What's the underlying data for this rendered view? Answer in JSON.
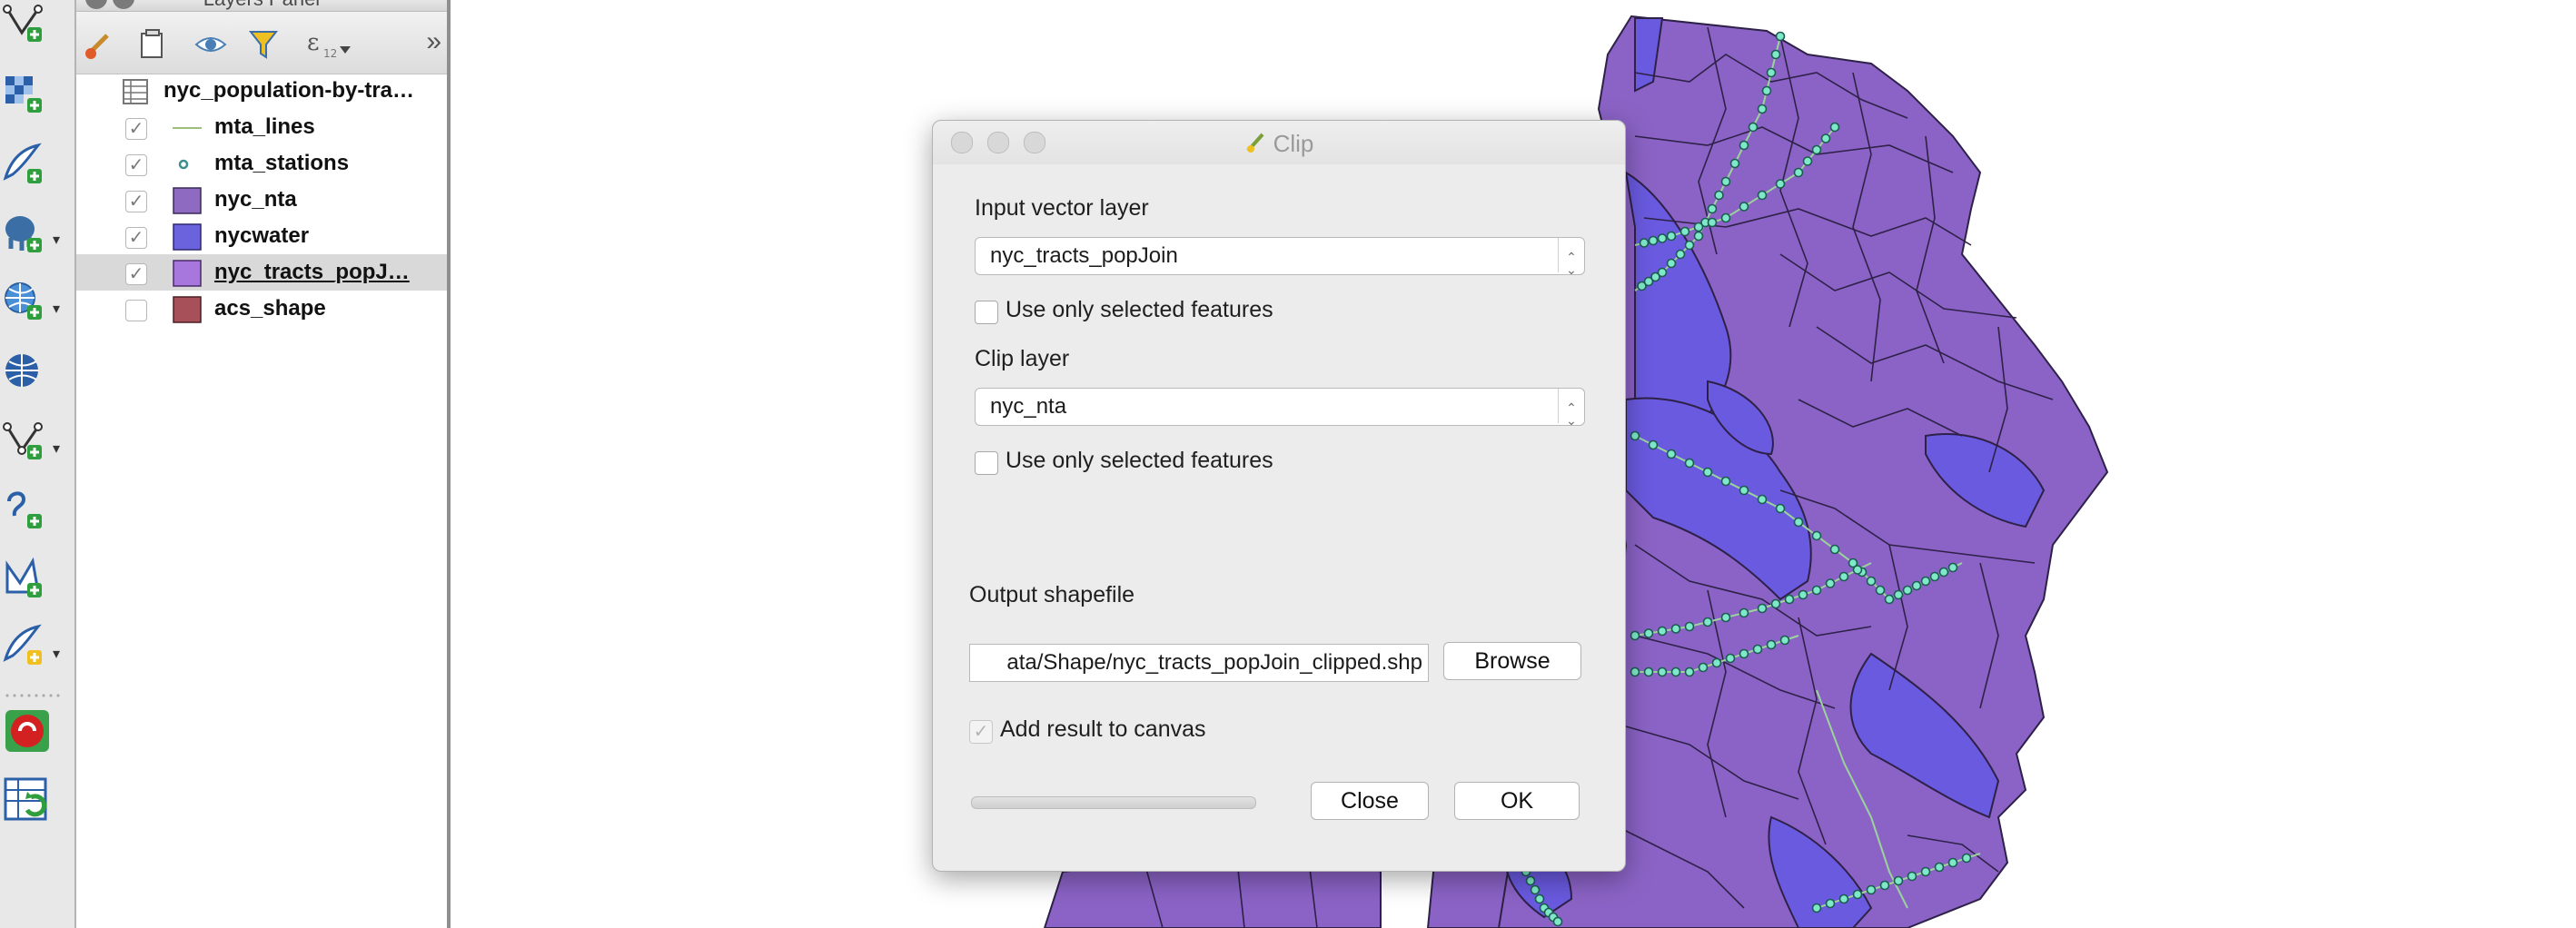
{
  "layers_panel": {
    "title": "Layers Panel",
    "layers": [
      {
        "label": "nyc_population-by-tra…",
        "symbol": "table",
        "visible": null
      },
      {
        "label": "mta_lines",
        "symbol": "line",
        "visible": true,
        "color": "#9cc07a"
      },
      {
        "label": "mta_stations",
        "symbol": "point",
        "visible": true,
        "color": "#3d8f8f"
      },
      {
        "label": "nyc_nta",
        "symbol": "fill",
        "visible": true,
        "color": "#8e6ac0"
      },
      {
        "label": "nycwater",
        "symbol": "fill",
        "visible": true,
        "color": "#6a63dd"
      },
      {
        "label": "nyc_tracts_popJ…",
        "symbol": "fill",
        "visible": true,
        "color": "#a877dd",
        "selected": true
      },
      {
        "label": "acs_shape",
        "symbol": "fill",
        "visible": false,
        "color": "#a8505a"
      }
    ],
    "check_glyph": "✓",
    "more_glyph": "»"
  },
  "map": {
    "land_color": "#8b63c6",
    "water_color": "#6a5ae0",
    "boundary_color": "#2e2148",
    "station_color": "#7fe8c8",
    "line_color": "#9bd49a"
  },
  "clip_dialog": {
    "title": "Clip",
    "input_layer_label": "Input vector layer",
    "input_layer_value": "nyc_tracts_popJoin",
    "input_selected_only": "Use only selected features",
    "clip_layer_label": "Clip layer",
    "clip_layer_value": "nyc_nta",
    "clip_selected_only": "Use only selected features",
    "output_label": "Output shapefile",
    "output_value": "ata/Shape/nyc_tracts_popJoin_clipped.shp",
    "browse_label": "Browse",
    "add_result_label": "Add result to canvas",
    "add_result_glyph": "✓",
    "close_label": "Close",
    "ok_label": "OK",
    "combo_arrow_glyph": "⌃⌄",
    "progress": 0
  }
}
